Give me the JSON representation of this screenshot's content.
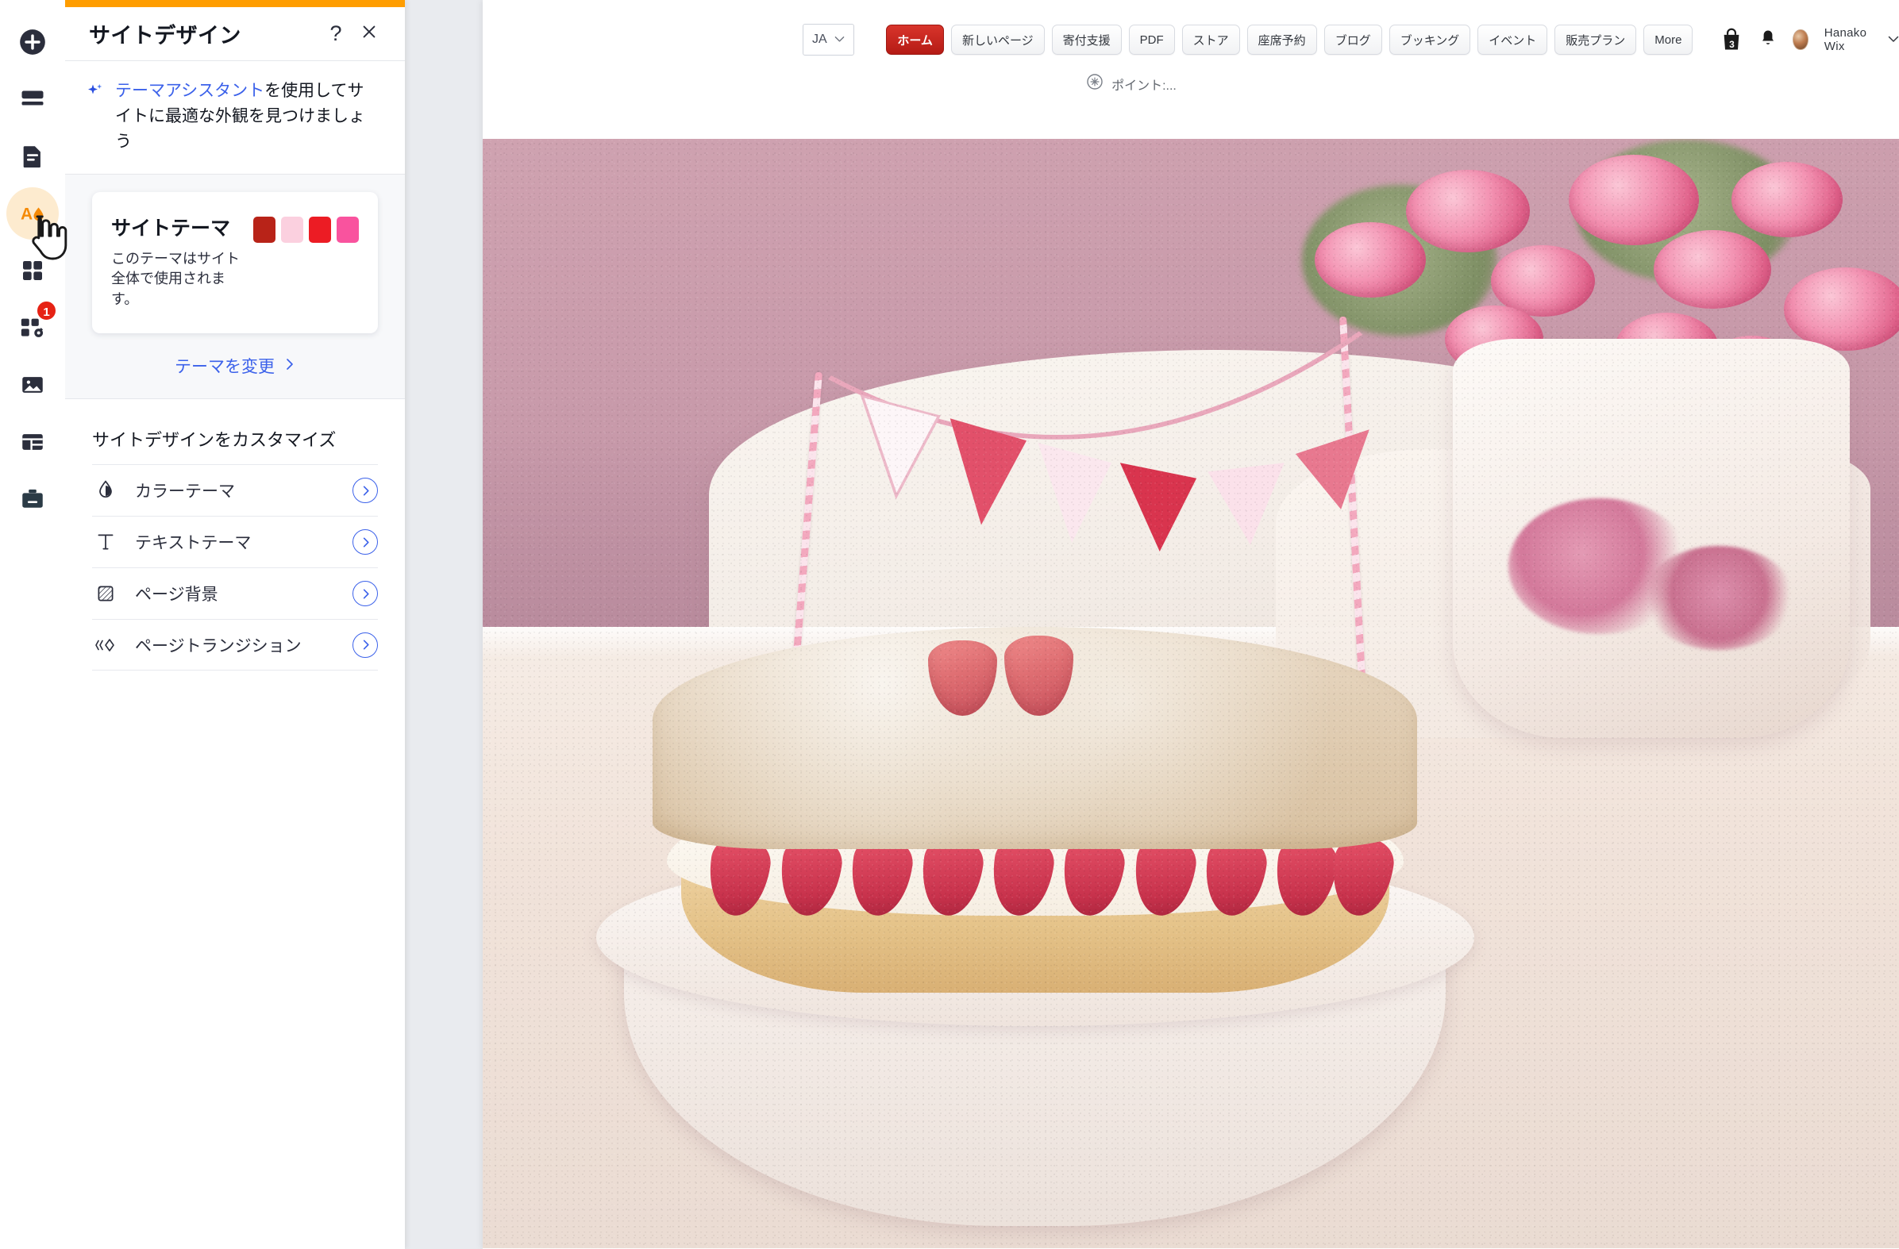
{
  "panel": {
    "accent_color": "#FF9D00",
    "title": "サイトデザイン",
    "help_icon": "question-mark-icon",
    "close_icon": "close-icon",
    "assistant": {
      "icon": "sparkle-icon",
      "link_text": "テーマアシスタント",
      "rest_text": "を使用してサイトに最適な外観を見つけましょう"
    },
    "theme_card": {
      "title": "サイトテーマ",
      "subtitle": "このテーマはサイト全体で使用されます。",
      "swatches": [
        "#B82318",
        "#FBD0DF",
        "#EC1C24",
        "#F9539E"
      ],
      "change_label": "テーマを変更",
      "change_chevron": "chevron-right-icon"
    },
    "customize_title": "サイトデザインをカスタマイズ",
    "menu_items": [
      {
        "label": "カラーテーマ",
        "icon": "droplet-icon"
      },
      {
        "label": "テキストテーマ",
        "icon": "text-t-icon"
      },
      {
        "label": "ページ背景",
        "icon": "hatched-square-icon"
      },
      {
        "label": "ページトランジション",
        "icon": "transition-diamond-icon"
      }
    ]
  },
  "rail": {
    "items": [
      {
        "name": "add-element",
        "icon": "plus-circle-icon",
        "badge": null,
        "active": false
      },
      {
        "name": "sections",
        "icon": "layers-icon",
        "badge": null,
        "active": false
      },
      {
        "name": "pages",
        "icon": "page-icon",
        "badge": null,
        "active": false
      },
      {
        "name": "site-design",
        "icon": "design-paint-icon",
        "badge": null,
        "active": true
      },
      {
        "name": "apps",
        "icon": "apps-grid-icon",
        "badge": null,
        "active": false
      },
      {
        "name": "app-market",
        "icon": "apps-gear-icon",
        "badge": "1",
        "active": false
      },
      {
        "name": "media",
        "icon": "image-icon",
        "badge": null,
        "active": false
      },
      {
        "name": "content-manager",
        "icon": "table-icon",
        "badge": null,
        "active": false
      },
      {
        "name": "business-tools",
        "icon": "briefcase-icon",
        "badge": null,
        "active": false
      }
    ]
  },
  "site": {
    "language": {
      "value": "JA",
      "chevron": "chevron-down-icon"
    },
    "nav_buttons": [
      {
        "label": "ホーム",
        "active": true
      },
      {
        "label": "新しいページ",
        "active": false
      },
      {
        "label": "寄付支援",
        "active": false
      },
      {
        "label": "PDF",
        "active": false
      },
      {
        "label": "ストア",
        "active": false
      },
      {
        "label": "座席予約",
        "active": false
      },
      {
        "label": "ブログ",
        "active": false
      },
      {
        "label": "ブッキング",
        "active": false
      },
      {
        "label": "イベント",
        "active": false
      },
      {
        "label": "販売プラン",
        "active": false
      },
      {
        "label": "More",
        "active": false
      }
    ],
    "cart": {
      "icon": "shopping-bag-icon",
      "count": "3"
    },
    "notifications_icon": "bell-icon",
    "account": {
      "avatar": "user-avatar",
      "name": "Hanako Wix",
      "chevron": "chevron-down-icon"
    },
    "points": {
      "icon": "points-badge-icon",
      "label": "ポイント:..."
    }
  }
}
